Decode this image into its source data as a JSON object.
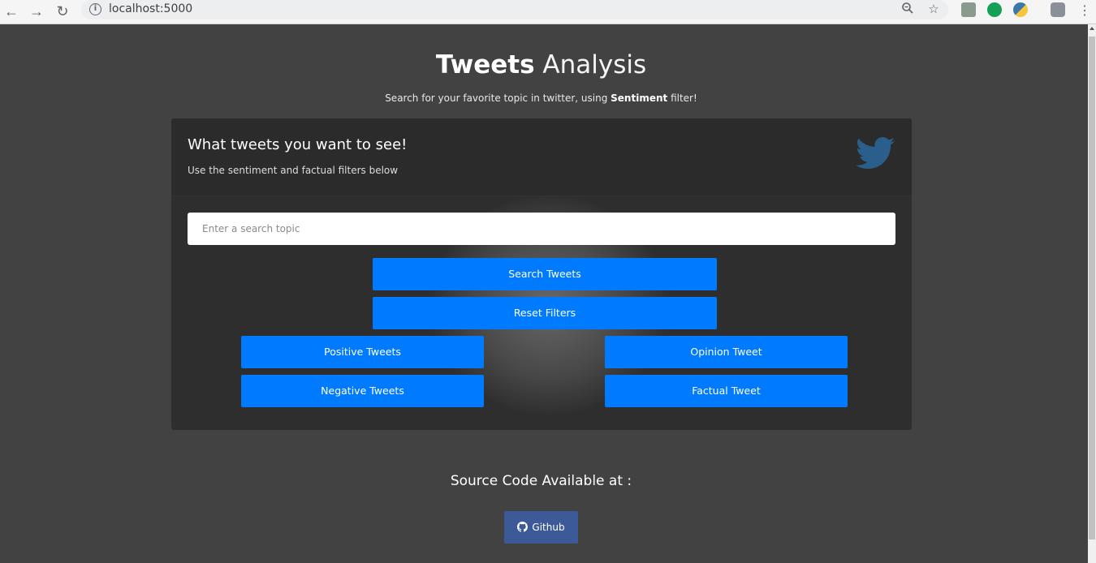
{
  "browser": {
    "url": "localhost:5000",
    "icons": [
      "back-arrow-icon",
      "forward-arrow-icon",
      "reload-icon",
      "info-icon",
      "zoom-icon",
      "star-icon",
      "extension-icon",
      "grammarly-icon",
      "python-icon",
      "profile-avatar",
      "menu-icon"
    ]
  },
  "header": {
    "title_bold": "Tweets",
    "title_light": "Analysis",
    "subtitle_pre": "Search for your favorite topic in twitter, using ",
    "subtitle_bold": "Sentiment",
    "subtitle_post": " filter!"
  },
  "card": {
    "title": "What tweets you want to see!",
    "subtitle": "Use the sentiment and factual filters below",
    "search_placeholder": "Enter a search topic",
    "buttons": {
      "search": "Search Tweets",
      "reset": "Reset Filters",
      "positive": "Positive Tweets",
      "negative": "Negative Tweets",
      "opinion": "Opinion Tweet",
      "factual": "Factual Tweet"
    }
  },
  "footer": {
    "source_label": "Source Code Available at :",
    "github_label": "Github"
  },
  "colors": {
    "page_bg": "#424242",
    "card_bg": "#2e2e2e",
    "primary_button": "#007bff",
    "github_button": "#3d5a98",
    "twitter_icon": "#2a5f8c"
  }
}
